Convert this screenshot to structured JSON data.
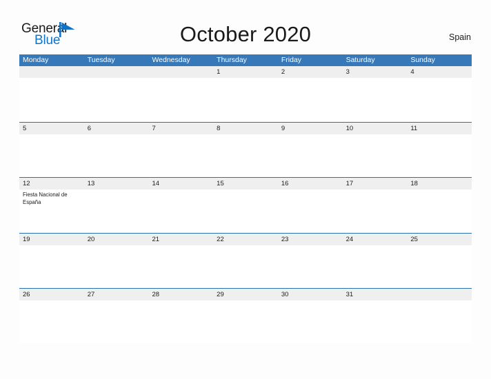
{
  "brand": {
    "name_part1": "General",
    "name_part2": "Blue",
    "flag_icon": "blue-triangle-flag",
    "accent_color": "#1273c4"
  },
  "header": {
    "title": "October 2020",
    "country": "Spain"
  },
  "colors": {
    "header_blue": "#3678b8",
    "separator_blue": "#2a6fae",
    "day_band_gray": "#efefef",
    "page_background": "#fdfdfd",
    "text": "#1a1a1a",
    "weekday_text": "#ffffff"
  },
  "calendar": {
    "weekdays": [
      "Monday",
      "Tuesday",
      "Wednesday",
      "Thursday",
      "Friday",
      "Saturday",
      "Sunday"
    ],
    "weeks": [
      {
        "days": [
          {
            "number": "",
            "events": []
          },
          {
            "number": "",
            "events": []
          },
          {
            "number": "",
            "events": []
          },
          {
            "number": "1",
            "events": []
          },
          {
            "number": "2",
            "events": []
          },
          {
            "number": "3",
            "events": []
          },
          {
            "number": "4",
            "events": []
          }
        ]
      },
      {
        "days": [
          {
            "number": "5",
            "events": []
          },
          {
            "number": "6",
            "events": []
          },
          {
            "number": "7",
            "events": []
          },
          {
            "number": "8",
            "events": []
          },
          {
            "number": "9",
            "events": []
          },
          {
            "number": "10",
            "events": []
          },
          {
            "number": "11",
            "events": []
          }
        ]
      },
      {
        "days": [
          {
            "number": "12",
            "events": [
              "Fiesta Nacional de España"
            ]
          },
          {
            "number": "13",
            "events": []
          },
          {
            "number": "14",
            "events": []
          },
          {
            "number": "15",
            "events": []
          },
          {
            "number": "16",
            "events": []
          },
          {
            "number": "17",
            "events": []
          },
          {
            "number": "18",
            "events": []
          }
        ]
      },
      {
        "days": [
          {
            "number": "19",
            "events": []
          },
          {
            "number": "20",
            "events": []
          },
          {
            "number": "21",
            "events": []
          },
          {
            "number": "22",
            "events": []
          },
          {
            "number": "23",
            "events": []
          },
          {
            "number": "24",
            "events": []
          },
          {
            "number": "25",
            "events": []
          }
        ]
      },
      {
        "days": [
          {
            "number": "26",
            "events": []
          },
          {
            "number": "27",
            "events": []
          },
          {
            "number": "28",
            "events": []
          },
          {
            "number": "29",
            "events": []
          },
          {
            "number": "30",
            "events": []
          },
          {
            "number": "31",
            "events": []
          },
          {
            "number": "",
            "events": []
          }
        ]
      }
    ]
  }
}
